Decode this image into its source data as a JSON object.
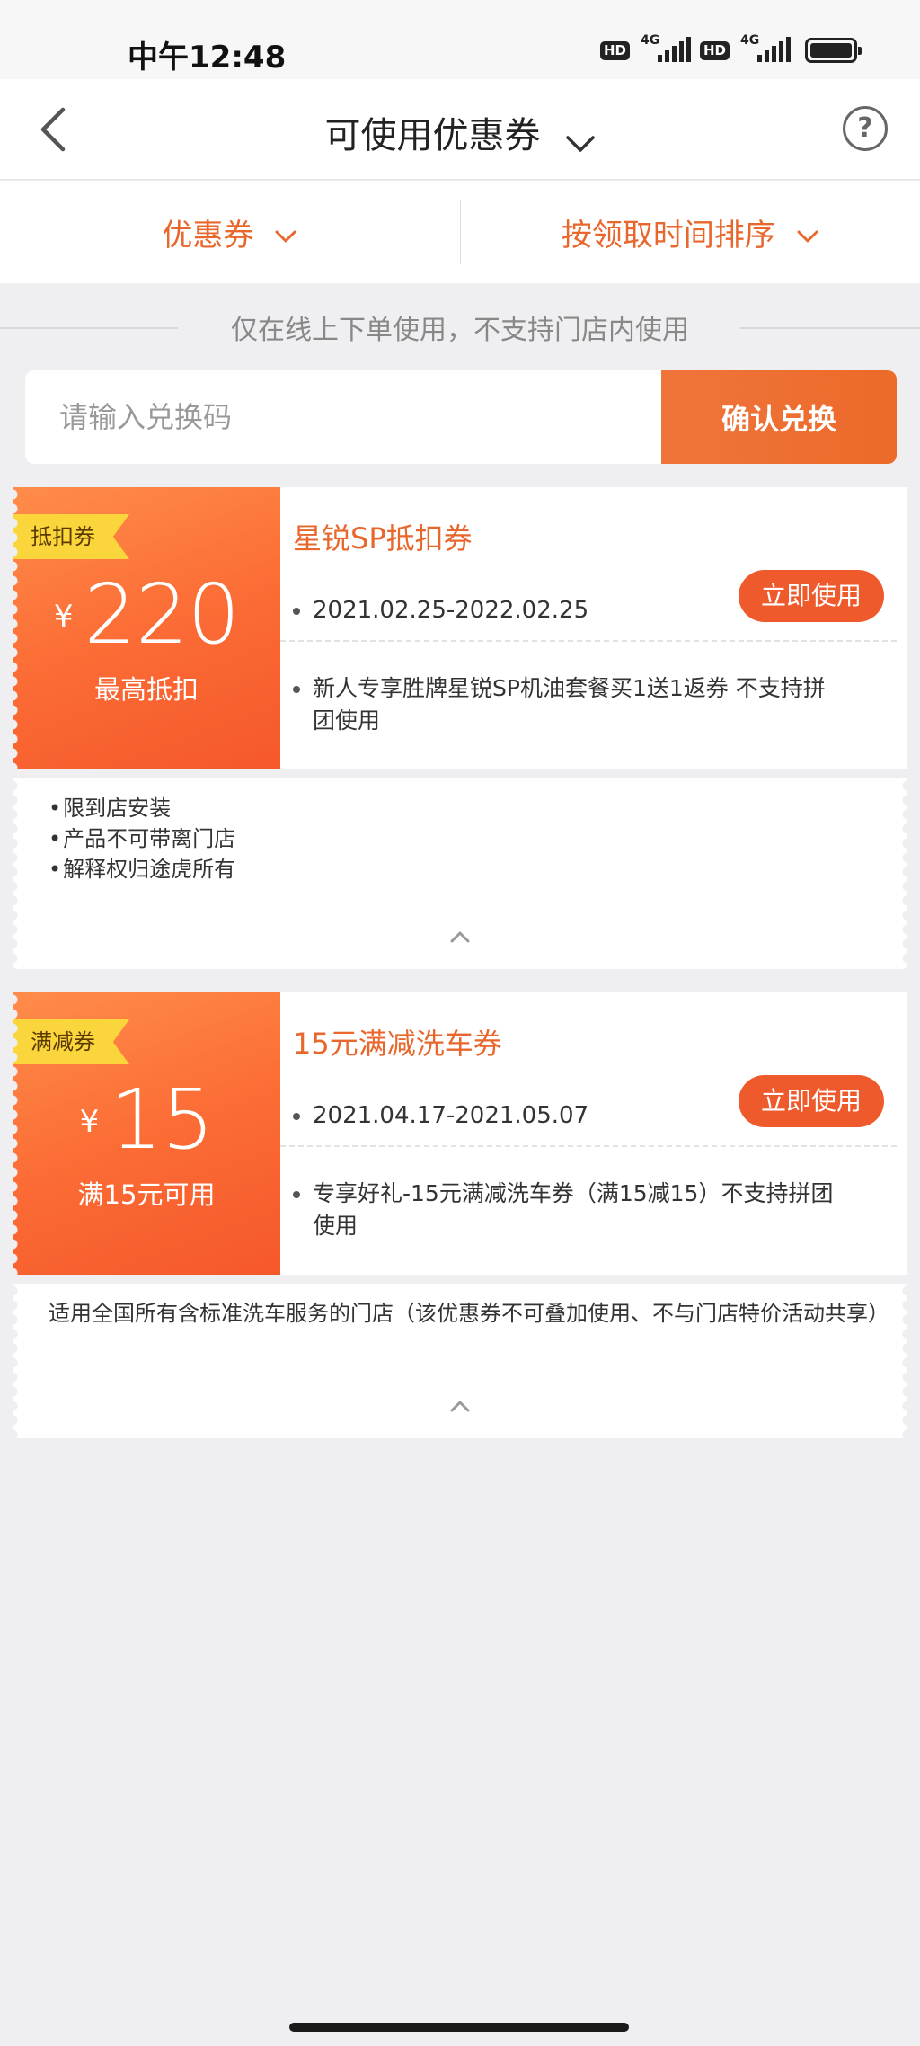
{
  "status_bar": {
    "time": "中午12:48",
    "hd_badge_1": "HD",
    "network_1": "4G",
    "hd_badge_2": "HD",
    "network_2": "4G"
  },
  "header": {
    "title": "可使用优惠券",
    "help_glyph": "?"
  },
  "filters": {
    "type_label": "优惠券",
    "sort_label": "按领取时间排序"
  },
  "notice": "仅在线上下单使用，不支持门店内使用",
  "redeem": {
    "placeholder": "请输入兑换码",
    "button_label": "确认兑换"
  },
  "coupons": [
    {
      "tag": "抵扣券",
      "currency": "¥",
      "amount": "220",
      "sub_label": "最高抵扣",
      "name": "星锐SP抵扣券",
      "date_range": "2021.02.25-2022.02.25",
      "use_button": "立即使用",
      "description": "新人专享胜牌星锐SP机油套餐买1送1返券 不支持拼团使用",
      "details": [
        "限到店安装",
        "产品不可带离门店",
        "解释权归途虎所有"
      ]
    },
    {
      "tag": "满减券",
      "currency": "¥",
      "amount": "15",
      "sub_label": "满15元可用",
      "name": "15元满减洗车券",
      "date_range": "2021.04.17-2021.05.07",
      "use_button": "立即使用",
      "description": "专享好礼-15元满减洗车券（满15减15）不支持拼团使用",
      "details": [
        "适用全国所有含标准洗车服务的门店（该优惠券不可叠加使用、不与门店特价活动共享）"
      ]
    }
  ],
  "icons": {
    "back": "back-arrow-icon",
    "title_caret": "chevron-down-icon",
    "help": "help-circle-icon",
    "filter_chevron": "chevron-down-icon",
    "collapse": "chevron-up-icon"
  },
  "colors": {
    "accent": "#e8672c",
    "button": "#ef5a2c",
    "tag": "#fbd53c",
    "background": "#efeff1"
  }
}
